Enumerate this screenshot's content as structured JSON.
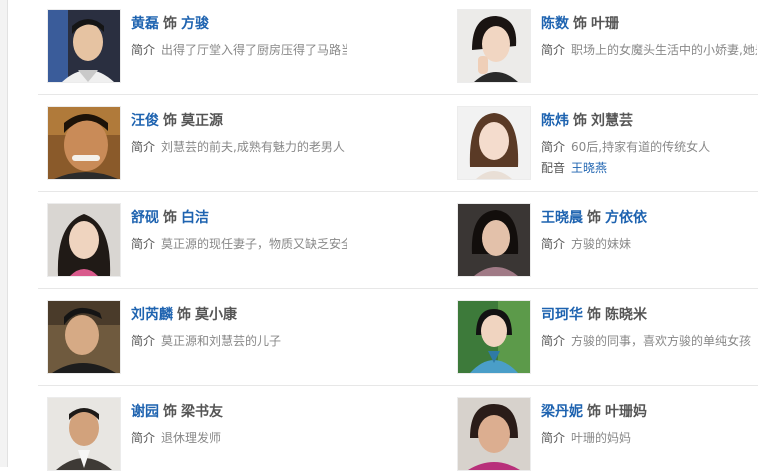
{
  "labels": {
    "as": "饰",
    "intro": "简介",
    "dub": "配音"
  },
  "left_column": [
    {
      "actor": "黄磊",
      "role": "方骏",
      "role_is_link": true,
      "intro": "出得了厅堂入得了厨房压得了马路当得了闺蜜...",
      "photo_icon": "actor-portrait"
    },
    {
      "actor": "汪俊",
      "role": "莫正源",
      "role_is_link": false,
      "intro": "刘慧芸的前夫,成熟有魅力的老男人",
      "photo_icon": "actor-portrait"
    },
    {
      "actor": "舒砚",
      "role": "白洁",
      "role_is_link": true,
      "intro": "莫正源的现任妻子，物质又缺乏安全感的女人",
      "photo_icon": "actor-portrait"
    },
    {
      "actor": "刘芮麟",
      "role": "莫小康",
      "role_is_link": false,
      "intro": "莫正源和刘慧芸的儿子",
      "photo_icon": "actor-portrait"
    },
    {
      "actor": "谢园",
      "role": "梁书友",
      "role_is_link": false,
      "intro": "退休理发师",
      "photo_icon": "actor-portrait"
    }
  ],
  "right_column": [
    {
      "actor": "陈数",
      "role": "叶珊",
      "role_is_link": false,
      "intro": "职场上的女魔头生活中的小娇妻,她是...",
      "photo_icon": "actor-portrait"
    },
    {
      "actor": "陈炜",
      "role": "刘慧芸",
      "role_is_link": false,
      "intro": "60后,持家有道的传统女人",
      "dub": "王晓燕",
      "photo_icon": "actor-portrait"
    },
    {
      "actor": "王晓晨",
      "role": "方依依",
      "role_is_link": true,
      "intro": "方骏的妹妹",
      "photo_icon": "actor-portrait"
    },
    {
      "actor": "司珂华",
      "role": "陈晓米",
      "role_is_link": false,
      "intro": "方骏的同事，喜欢方骏的单纯女孩",
      "photo_icon": "actor-portrait"
    },
    {
      "actor": "梁丹妮",
      "role": "叶珊妈",
      "role_is_link": false,
      "intro": "叶珊的妈妈",
      "photo_icon": "actor-portrait"
    }
  ],
  "colors": {
    "link": "#1e63b0",
    "text": "#555555",
    "muted": "#888888",
    "separator": "#e7e7e7"
  }
}
